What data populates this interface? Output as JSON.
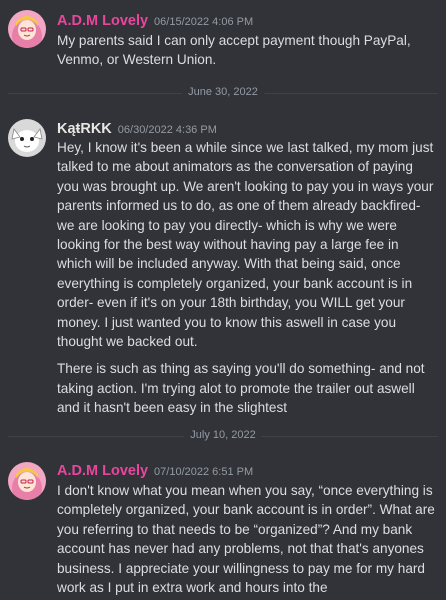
{
  "colors": {
    "background": "#313338",
    "adm_name": "#eb459e",
    "kat_name": "#e9e7e3",
    "timestamp": "#949ba4",
    "message_text": "#dbdee1"
  },
  "messages": [
    {
      "author": "A.D.M Lovely",
      "timestamp": "06/15/2022 4:06 PM",
      "avatar_icon": "pink-hair-girl-avatar-icon",
      "paragraphs": [
        "My parents said I can only accept payment though PayPal, Venmo, or Western Union."
      ]
    },
    {
      "author": "KąŧRKK",
      "timestamp": "06/30/2022 4:36 PM",
      "avatar_icon": "white-creature-avatar-icon",
      "paragraphs": [
        "Hey, I know it's been a while since we last talked, my mom just talked to me about animators as the conversation of paying you was brought up. We aren't looking to pay you in ways your parents informed us to do, as one of them already backfired- we are looking to pay you directly- which is why we were looking for the best way without having pay a large fee in which will be included anyway. With that being said, once everything is completely organized, your bank account is in order- even if it's on your 18th birthday, you WILL get your money. I just wanted you to know this aswell in case you thought we backed out.",
        "There is such as thing as saying you'll do something- and not taking action. I'm trying alot to promote the trailer out aswell and it hasn't been easy in the slightest"
      ]
    },
    {
      "author": "A.D.M Lovely",
      "timestamp": "07/10/2022 6:51 PM",
      "avatar_icon": "pink-hair-girl-avatar-icon",
      "paragraphs": [
        "I don't know what you mean when you say, “once everything is completely organized, your bank account is in order”. What are you referring to that needs to be “organized”? And my bank account has never had any problems, not that that's anyones business. I appreciate your willingness to pay me for my hard work as I put in extra work and hours into the"
      ]
    }
  ],
  "dividers": [
    "June 30, 2022",
    "July 10, 2022"
  ]
}
